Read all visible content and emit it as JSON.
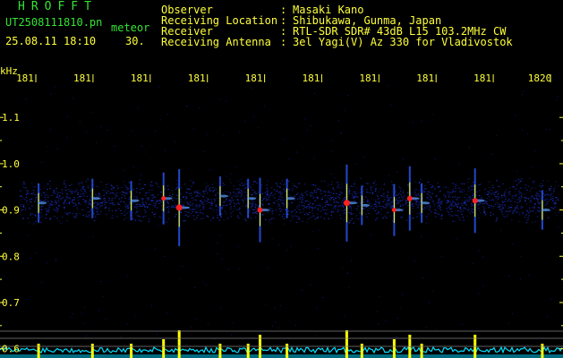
{
  "header": {
    "title": "HROFFT",
    "filename": "UT2508111810.pn",
    "meteor_label": "meteor",
    "datetime": "25.08.11 18:10",
    "count": "30.",
    "observer_label": "Observer",
    "observer_value": "Masaki Kano",
    "location_label": "Receiving Location",
    "location_value": "Shibukawa, Gunma, Japan",
    "receiver_label": "Receiver",
    "receiver_value": "RTL-SDR SDR# 43dB L15 103.2MHz CW",
    "antenna_label": "Receiving Antenna",
    "antenna_value": "3el Yagi(V) Az 330 for Vladivostok",
    "separator": ":"
  },
  "axis": {
    "unit": "kHz",
    "y_ticks": [
      "1.1",
      "1.0",
      "0.9",
      "0.8",
      "0.7",
      "0.6"
    ],
    "x_ticks": [
      "181",
      "181",
      "181",
      "181",
      "181",
      "181",
      "181",
      "181",
      "181",
      "1820"
    ]
  },
  "colors": {
    "background": "#000000",
    "header_green": "#34e434",
    "header_yellow": "#ffff3a",
    "noise_blue": "#1020a0",
    "echo_red": "#ff2020",
    "level_cyan": "#00e0ff",
    "level_yellow": "#ffff00",
    "grid_gray": "#808080"
  },
  "chart_data": {
    "type": "heatmap",
    "title": "",
    "xlabel": "",
    "ylabel": "kHz",
    "y_range": [
      0.58,
      1.17
    ],
    "noise_band": [
      0.87,
      0.97
    ],
    "meteor_echoes": [
      {
        "t": 0.035,
        "f": 0.915,
        "strength": 2
      },
      {
        "t": 0.135,
        "f": 0.925,
        "strength": 2
      },
      {
        "t": 0.207,
        "f": 0.92,
        "strength": 2
      },
      {
        "t": 0.267,
        "f": 0.925,
        "strength": 3
      },
      {
        "t": 0.296,
        "f": 0.905,
        "strength": 5
      },
      {
        "t": 0.372,
        "f": 0.93,
        "strength": 2
      },
      {
        "t": 0.424,
        "f": 0.925,
        "strength": 2
      },
      {
        "t": 0.446,
        "f": 0.9,
        "strength": 4
      },
      {
        "t": 0.496,
        "f": 0.925,
        "strength": 2
      },
      {
        "t": 0.607,
        "f": 0.915,
        "strength": 5
      },
      {
        "t": 0.635,
        "f": 0.91,
        "strength": 2
      },
      {
        "t": 0.695,
        "f": 0.9,
        "strength": 3
      },
      {
        "t": 0.724,
        "f": 0.925,
        "strength": 4
      },
      {
        "t": 0.746,
        "f": 0.915,
        "strength": 2
      },
      {
        "t": 0.845,
        "f": 0.92,
        "strength": 4
      },
      {
        "t": 0.97,
        "f": 0.9,
        "strength": 2
      }
    ]
  }
}
